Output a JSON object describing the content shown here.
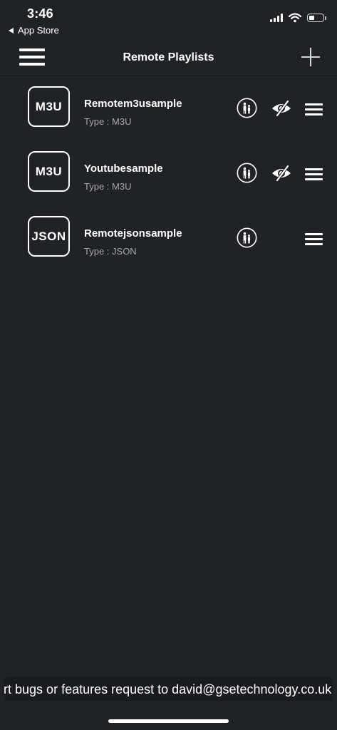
{
  "status_bar": {
    "time": "3:46",
    "back_label": "App Store",
    "battery_level": 0.42
  },
  "nav": {
    "title": "Remote Playlists"
  },
  "playlists": [
    {
      "badge": "M3U",
      "name": "Remotem3usample",
      "type": "Type : M3U",
      "hidden_toggle": true
    },
    {
      "badge": "M3U",
      "name": "Youtubesample",
      "type": "Type : M3U",
      "hidden_toggle": true
    },
    {
      "badge": "JSON",
      "name": "Remotejsonsample",
      "type": "Type : JSON",
      "hidden_toggle": false
    }
  ],
  "footer": {
    "ticker_text": "Report bugs or features request to david@gsetechnology.co.uk"
  },
  "colors": {
    "background": "#1f2326",
    "ticker_background": "#191c1f",
    "secondary_text": "#a6a8aa"
  },
  "icons": {
    "menu": "hamburger-menu-icon",
    "add": "plus-icon",
    "family": "family-icon",
    "hidden": "eye-slash-icon",
    "drag": "drag-handle-icon"
  }
}
